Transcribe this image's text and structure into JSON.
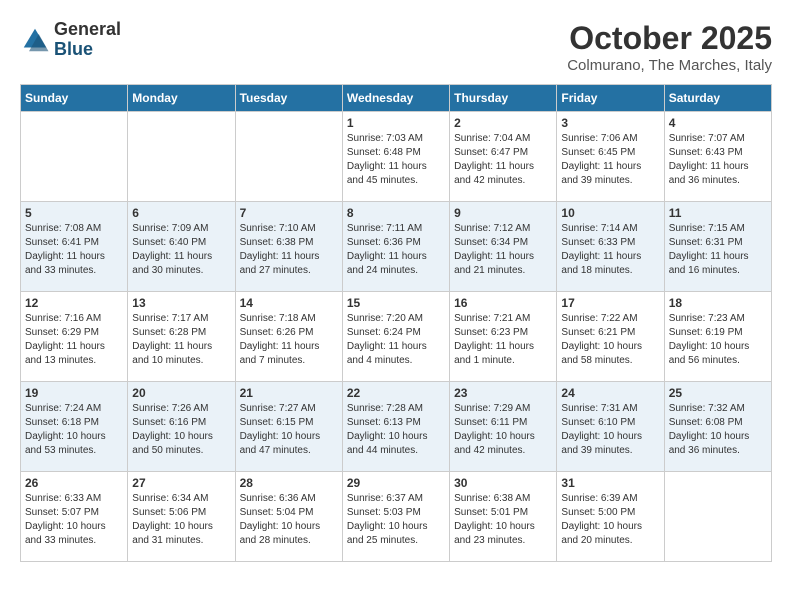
{
  "header": {
    "logo_general": "General",
    "logo_blue": "Blue",
    "title": "October 2025",
    "location": "Colmurano, The Marches, Italy"
  },
  "weekdays": [
    "Sunday",
    "Monday",
    "Tuesday",
    "Wednesday",
    "Thursday",
    "Friday",
    "Saturday"
  ],
  "weeks": [
    [
      {
        "day": "",
        "info": ""
      },
      {
        "day": "",
        "info": ""
      },
      {
        "day": "",
        "info": ""
      },
      {
        "day": "1",
        "info": "Sunrise: 7:03 AM\nSunset: 6:48 PM\nDaylight: 11 hours\nand 45 minutes."
      },
      {
        "day": "2",
        "info": "Sunrise: 7:04 AM\nSunset: 6:47 PM\nDaylight: 11 hours\nand 42 minutes."
      },
      {
        "day": "3",
        "info": "Sunrise: 7:06 AM\nSunset: 6:45 PM\nDaylight: 11 hours\nand 39 minutes."
      },
      {
        "day": "4",
        "info": "Sunrise: 7:07 AM\nSunset: 6:43 PM\nDaylight: 11 hours\nand 36 minutes."
      }
    ],
    [
      {
        "day": "5",
        "info": "Sunrise: 7:08 AM\nSunset: 6:41 PM\nDaylight: 11 hours\nand 33 minutes."
      },
      {
        "day": "6",
        "info": "Sunrise: 7:09 AM\nSunset: 6:40 PM\nDaylight: 11 hours\nand 30 minutes."
      },
      {
        "day": "7",
        "info": "Sunrise: 7:10 AM\nSunset: 6:38 PM\nDaylight: 11 hours\nand 27 minutes."
      },
      {
        "day": "8",
        "info": "Sunrise: 7:11 AM\nSunset: 6:36 PM\nDaylight: 11 hours\nand 24 minutes."
      },
      {
        "day": "9",
        "info": "Sunrise: 7:12 AM\nSunset: 6:34 PM\nDaylight: 11 hours\nand 21 minutes."
      },
      {
        "day": "10",
        "info": "Sunrise: 7:14 AM\nSunset: 6:33 PM\nDaylight: 11 hours\nand 18 minutes."
      },
      {
        "day": "11",
        "info": "Sunrise: 7:15 AM\nSunset: 6:31 PM\nDaylight: 11 hours\nand 16 minutes."
      }
    ],
    [
      {
        "day": "12",
        "info": "Sunrise: 7:16 AM\nSunset: 6:29 PM\nDaylight: 11 hours\nand 13 minutes."
      },
      {
        "day": "13",
        "info": "Sunrise: 7:17 AM\nSunset: 6:28 PM\nDaylight: 11 hours\nand 10 minutes."
      },
      {
        "day": "14",
        "info": "Sunrise: 7:18 AM\nSunset: 6:26 PM\nDaylight: 11 hours\nand 7 minutes."
      },
      {
        "day": "15",
        "info": "Sunrise: 7:20 AM\nSunset: 6:24 PM\nDaylight: 11 hours\nand 4 minutes."
      },
      {
        "day": "16",
        "info": "Sunrise: 7:21 AM\nSunset: 6:23 PM\nDaylight: 11 hours\nand 1 minute."
      },
      {
        "day": "17",
        "info": "Sunrise: 7:22 AM\nSunset: 6:21 PM\nDaylight: 10 hours\nand 58 minutes."
      },
      {
        "day": "18",
        "info": "Sunrise: 7:23 AM\nSunset: 6:19 PM\nDaylight: 10 hours\nand 56 minutes."
      }
    ],
    [
      {
        "day": "19",
        "info": "Sunrise: 7:24 AM\nSunset: 6:18 PM\nDaylight: 10 hours\nand 53 minutes."
      },
      {
        "day": "20",
        "info": "Sunrise: 7:26 AM\nSunset: 6:16 PM\nDaylight: 10 hours\nand 50 minutes."
      },
      {
        "day": "21",
        "info": "Sunrise: 7:27 AM\nSunset: 6:15 PM\nDaylight: 10 hours\nand 47 minutes."
      },
      {
        "day": "22",
        "info": "Sunrise: 7:28 AM\nSunset: 6:13 PM\nDaylight: 10 hours\nand 44 minutes."
      },
      {
        "day": "23",
        "info": "Sunrise: 7:29 AM\nSunset: 6:11 PM\nDaylight: 10 hours\nand 42 minutes."
      },
      {
        "day": "24",
        "info": "Sunrise: 7:31 AM\nSunset: 6:10 PM\nDaylight: 10 hours\nand 39 minutes."
      },
      {
        "day": "25",
        "info": "Sunrise: 7:32 AM\nSunset: 6:08 PM\nDaylight: 10 hours\nand 36 minutes."
      }
    ],
    [
      {
        "day": "26",
        "info": "Sunrise: 6:33 AM\nSunset: 5:07 PM\nDaylight: 10 hours\nand 33 minutes."
      },
      {
        "day": "27",
        "info": "Sunrise: 6:34 AM\nSunset: 5:06 PM\nDaylight: 10 hours\nand 31 minutes."
      },
      {
        "day": "28",
        "info": "Sunrise: 6:36 AM\nSunset: 5:04 PM\nDaylight: 10 hours\nand 28 minutes."
      },
      {
        "day": "29",
        "info": "Sunrise: 6:37 AM\nSunset: 5:03 PM\nDaylight: 10 hours\nand 25 minutes."
      },
      {
        "day": "30",
        "info": "Sunrise: 6:38 AM\nSunset: 5:01 PM\nDaylight: 10 hours\nand 23 minutes."
      },
      {
        "day": "31",
        "info": "Sunrise: 6:39 AM\nSunset: 5:00 PM\nDaylight: 10 hours\nand 20 minutes."
      },
      {
        "day": "",
        "info": ""
      }
    ]
  ]
}
